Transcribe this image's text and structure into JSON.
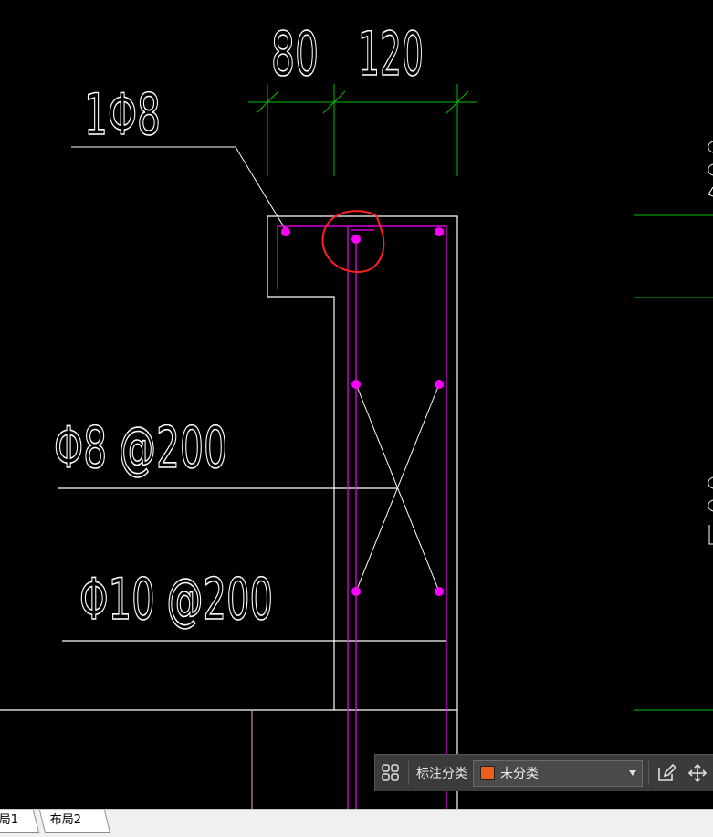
{
  "drawing": {
    "dims_top": [
      "80",
      "120"
    ],
    "bar_label": "1Φ8",
    "stirrup_label": "Φ8 @200",
    "tie_label": "Φ10 @200"
  },
  "toolbar": {
    "category_label": "标注分类",
    "category_value": "未分类",
    "swatch_color": "#e8601c"
  },
  "tabs": [
    "局1",
    "布局2"
  ],
  "colors": {
    "background": "#000000",
    "dimension_lines": "#00c000",
    "outline": "#ffffff",
    "rebar": "#ff00ff",
    "highlight_circle": "#ff2020"
  }
}
